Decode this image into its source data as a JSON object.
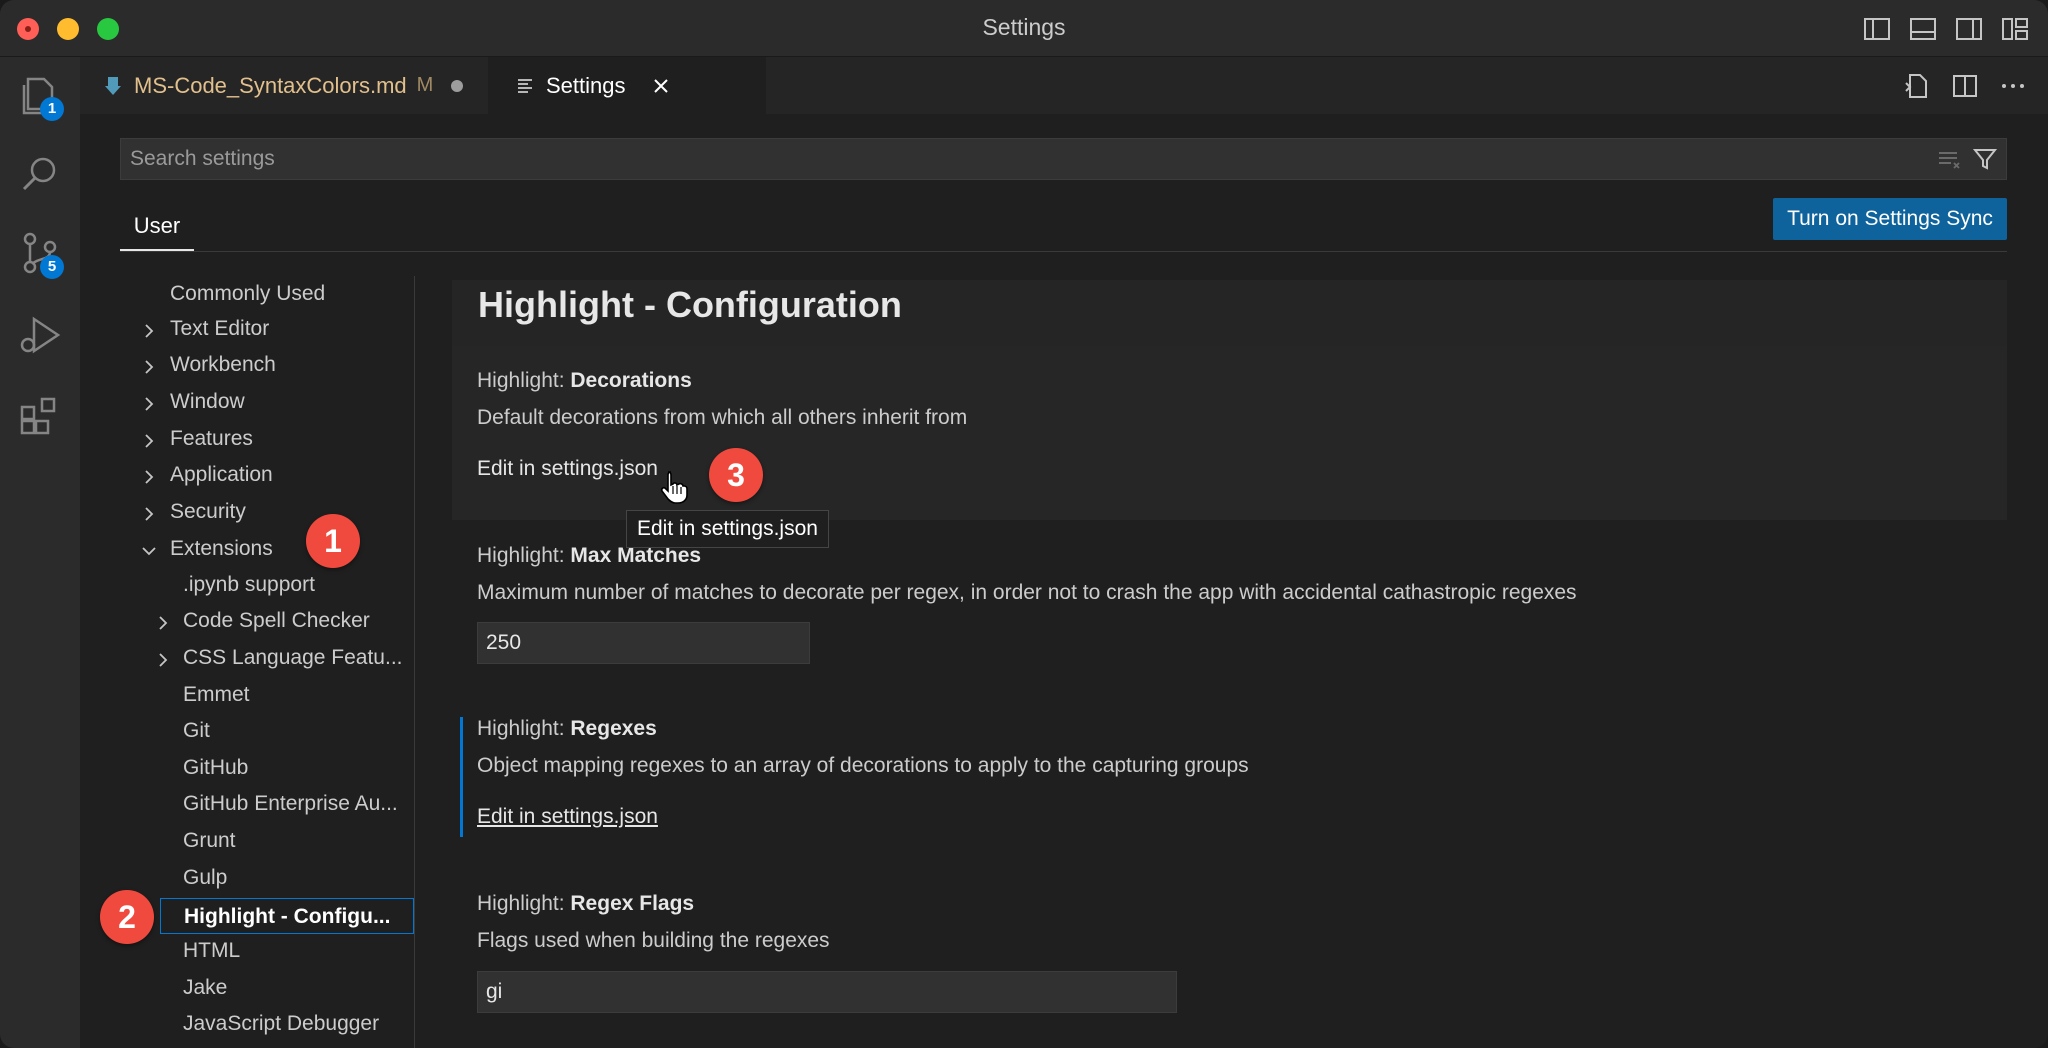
{
  "window": {
    "title": "Settings"
  },
  "activity_bar": {
    "explorer_badge": "1",
    "scm_badge": "5"
  },
  "tabs": [
    {
      "label": "MS-Code_SyntaxColors.md",
      "status": "M"
    },
    {
      "label": "Settings"
    }
  ],
  "search": {
    "placeholder": "Search settings"
  },
  "scope_tab": "User",
  "sync_button": "Turn on Settings Sync",
  "toc": {
    "items": [
      "Commonly Used",
      "Text Editor",
      "Workbench",
      "Window",
      "Features",
      "Application",
      "Security",
      "Extensions"
    ],
    "extension_items": [
      ".ipynb support",
      "Code Spell Checker",
      "CSS Language Featu...",
      "Emmet",
      "Git",
      "GitHub",
      "GitHub Enterprise Au...",
      "Grunt",
      "Gulp",
      "Highlight - Configu...",
      "HTML",
      "Jake",
      "JavaScript Debugger"
    ]
  },
  "main": {
    "group_title": "Highlight - Configuration",
    "settings": [
      {
        "category": "Highlight: ",
        "name": "Decorations",
        "description": "Default decorations from which all others inherit from",
        "link": "Edit in settings.json"
      },
      {
        "category": "Highlight: ",
        "name": "Max Matches",
        "description": "Maximum number of matches to decorate per regex, in order not to crash the app with accidental cathastropic regexes",
        "value": "250"
      },
      {
        "category": "Highlight: ",
        "name": "Regexes",
        "description": "Object mapping regexes to an array of decorations to apply to the capturing groups",
        "link": "Edit in settings.json"
      },
      {
        "category": "Highlight: ",
        "name": "Regex Flags",
        "description": "Flags used when building the regexes",
        "value": "gi"
      }
    ]
  },
  "tooltip": "Edit in settings.json",
  "callouts": [
    "1",
    "2",
    "3"
  ],
  "colors": {
    "accent": "#0078d4",
    "sync_button": "#0e639c",
    "callout": "#f04a3e",
    "modified_tab": "#e2c08d"
  }
}
